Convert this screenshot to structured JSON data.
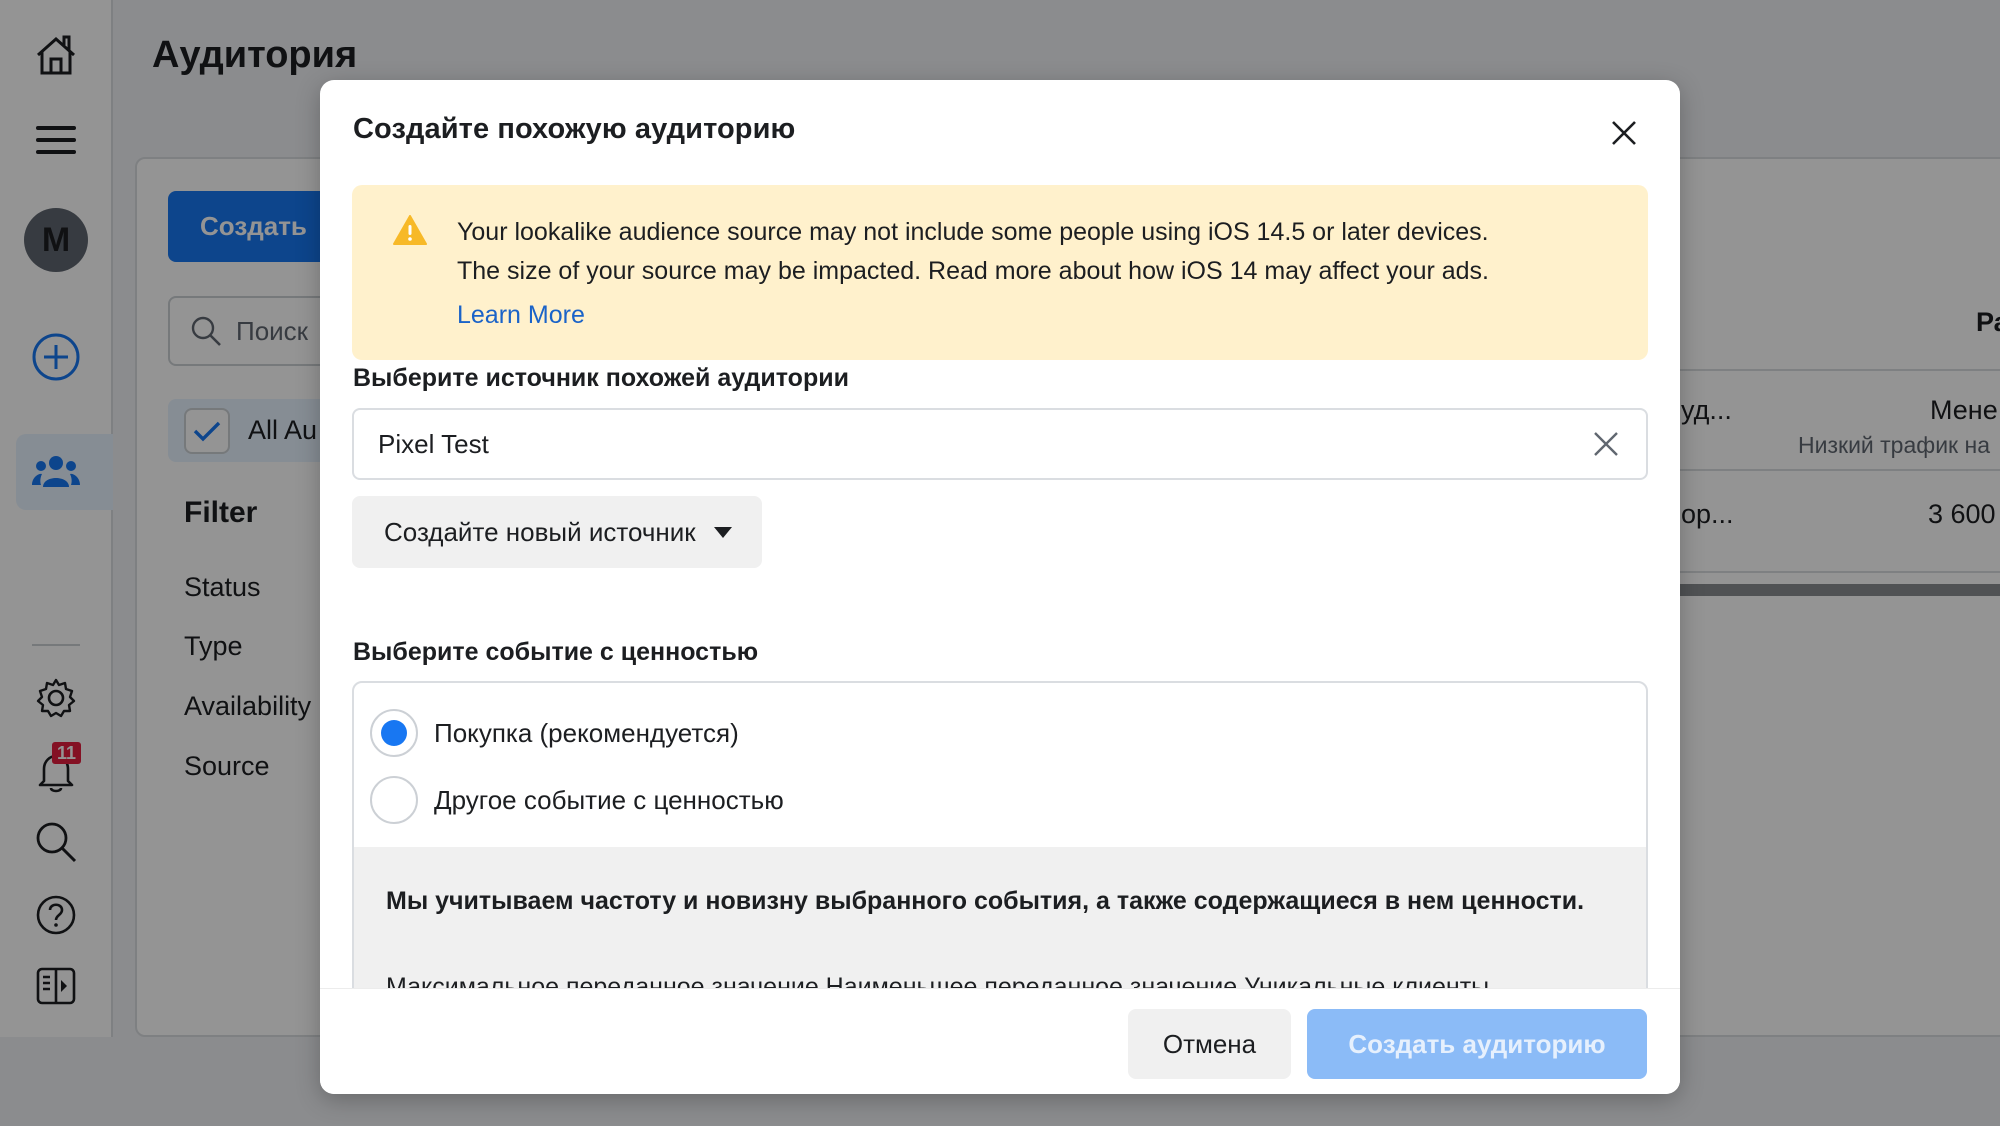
{
  "background": {
    "page_title": "Аудитория",
    "sidebar": {
      "avatar_initial": "M",
      "notification_count": "11",
      "icons": [
        "home-icon",
        "menu-icon",
        "avatar",
        "add-icon",
        "audience-icon",
        "settings-icon",
        "notifications-icon",
        "search-icon",
        "help-icon",
        "panel-icon"
      ]
    },
    "create_button": "Создать",
    "search_placeholder": "Поиск",
    "all_audiences_label": "All Au",
    "filter": {
      "title": "Filter",
      "items": [
        "Status",
        "Type",
        "Availability",
        "Source"
      ]
    },
    "table": {
      "header_partial": "Ра",
      "rows": [
        {
          "name_partial": "уд...",
          "size_partial": "Мене",
          "size_note_partial": "Низкий трафик на"
        },
        {
          "name_partial": "ор...",
          "size_partial": "3 600"
        }
      ]
    }
  },
  "modal": {
    "title": "Создайте похожую аудиторию",
    "warning": {
      "line1": "Your lookalike audience source may not include some people using iOS 14.5 or later devices.",
      "line2": "The size of your source may be impacted. Read more about how iOS 14 may affect your ads.",
      "link": "Learn More"
    },
    "source_label": "Выберите источник похожей аудитории",
    "source_value": "Pixel Test",
    "new_source_button": "Создайте новый источник",
    "event_label": "Выберите событие с ценностью",
    "event_options": [
      {
        "label": "Покупка (рекомендуется)",
        "selected": true
      },
      {
        "label": "Другое событие с ценностью",
        "selected": false
      }
    ],
    "info_bold": "Мы учитываем частоту и новизну выбранного события, а также содержащиеся в нем ценности.",
    "info_cut": "Максимальное переданное значение Наименьшее переданное значение Уникальные клиенты",
    "cancel_button": "Отмена",
    "create_button": "Создать аудиторию"
  },
  "colors": {
    "accent": "#1877f2",
    "warning_bg": "#fff1cc",
    "warning_icon": "#f7b928",
    "link": "#1a63c8",
    "disabled_primary": "#8bbbf7",
    "badge": "#e41e3f"
  }
}
